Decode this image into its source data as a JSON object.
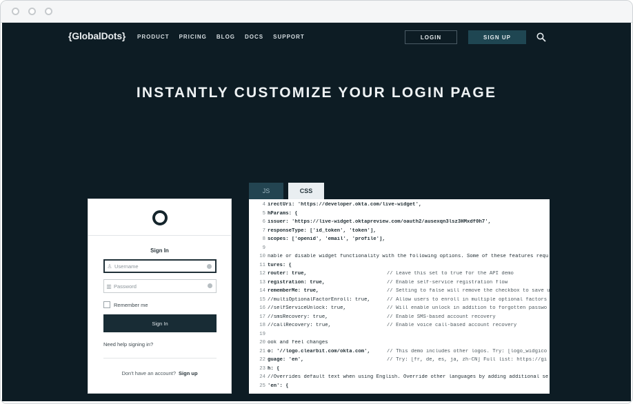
{
  "nav": {
    "logo": "{GlobalDots}",
    "links": [
      "PRODUCT",
      "PRICING",
      "BLOG",
      "DOCS",
      "SUPPORT"
    ],
    "login": "LOGIN",
    "signup": "SIGN UP"
  },
  "hero": {
    "title": "INSTANTLY CUSTOMIZE YOUR LOGIN PAGE"
  },
  "widget": {
    "title": "Sign In",
    "username_placeholder": "Username",
    "password_placeholder": "Password",
    "remember": "Remember me",
    "submit": "Sign In",
    "help": "Need help signing in?",
    "no_account": "Don't have an account?",
    "signup": "Sign up"
  },
  "tabs": {
    "js": "JS",
    "css": "CSS"
  },
  "code": [
    {
      "n": "4",
      "t": "irectUri: 'https://developer.okta.com/live-widget',",
      "c": ""
    },
    {
      "n": "5",
      "t": "hParams: {",
      "c": ""
    },
    {
      "n": "6",
      "t": "issuer: 'https://live-widget.oktapreview.com/oauth2/ausexqn3lsz3HMxdf0h7',",
      "c": ""
    },
    {
      "n": "7",
      "t": "responseType: ['id_token', 'token'],",
      "c": ""
    },
    {
      "n": "8",
      "t": "scopes: ['openid', 'email', 'profile'],",
      "c": ""
    },
    {
      "n": "9",
      "t": "",
      "c": ""
    },
    {
      "n": "10",
      "t": "nable or disable widget functionality with the following options. Some of these features requ",
      "c": ""
    },
    {
      "n": "11",
      "t": "tures: {",
      "c": ""
    },
    {
      "n": "12",
      "t": "router: true,",
      "c": "// Leave this set to true for the API demo"
    },
    {
      "n": "13",
      "t": "registration: true,",
      "c": "// Enable self-service registration flow"
    },
    {
      "n": "14",
      "t": "rememberMe: true,",
      "c": "// Setting to false will remove the checkbox to save u"
    },
    {
      "n": "15",
      "t": "//multiOptionalFactorEnroll: true,",
      "c": "// Allow users to enroll in multiple optional factors"
    },
    {
      "n": "16",
      "t": "//selfServiceUnlock: true,",
      "c": "// Will enable unlock in addition to forgotten passwo"
    },
    {
      "n": "17",
      "t": "//smsRecovery: true,",
      "c": "// Enable SMS-based account recovery"
    },
    {
      "n": "18",
      "t": "//callRecovery: true,",
      "c": "// Enable voice call-based account recovery"
    },
    {
      "n": "19",
      "t": "",
      "c": ""
    },
    {
      "n": "20",
      "t": "ook and feel changes",
      "c": ""
    },
    {
      "n": "21",
      "t": "o: '//logo.clearbit.com/okta.com',",
      "c": "// This demo includes other logos. Try: [logo_widgico"
    },
    {
      "n": "22",
      "t": "guage: 'en',",
      "c": "// Try: [fr, de, es, ja, zh-CN] Full list: https://gi"
    },
    {
      "n": "23",
      "t": "h: {",
      "c": ""
    },
    {
      "n": "24",
      "t": "//Overrides default text when using English. Override other languages by adding additional se",
      "c": ""
    },
    {
      "n": "25",
      "t": "'en': {",
      "c": ""
    }
  ]
}
